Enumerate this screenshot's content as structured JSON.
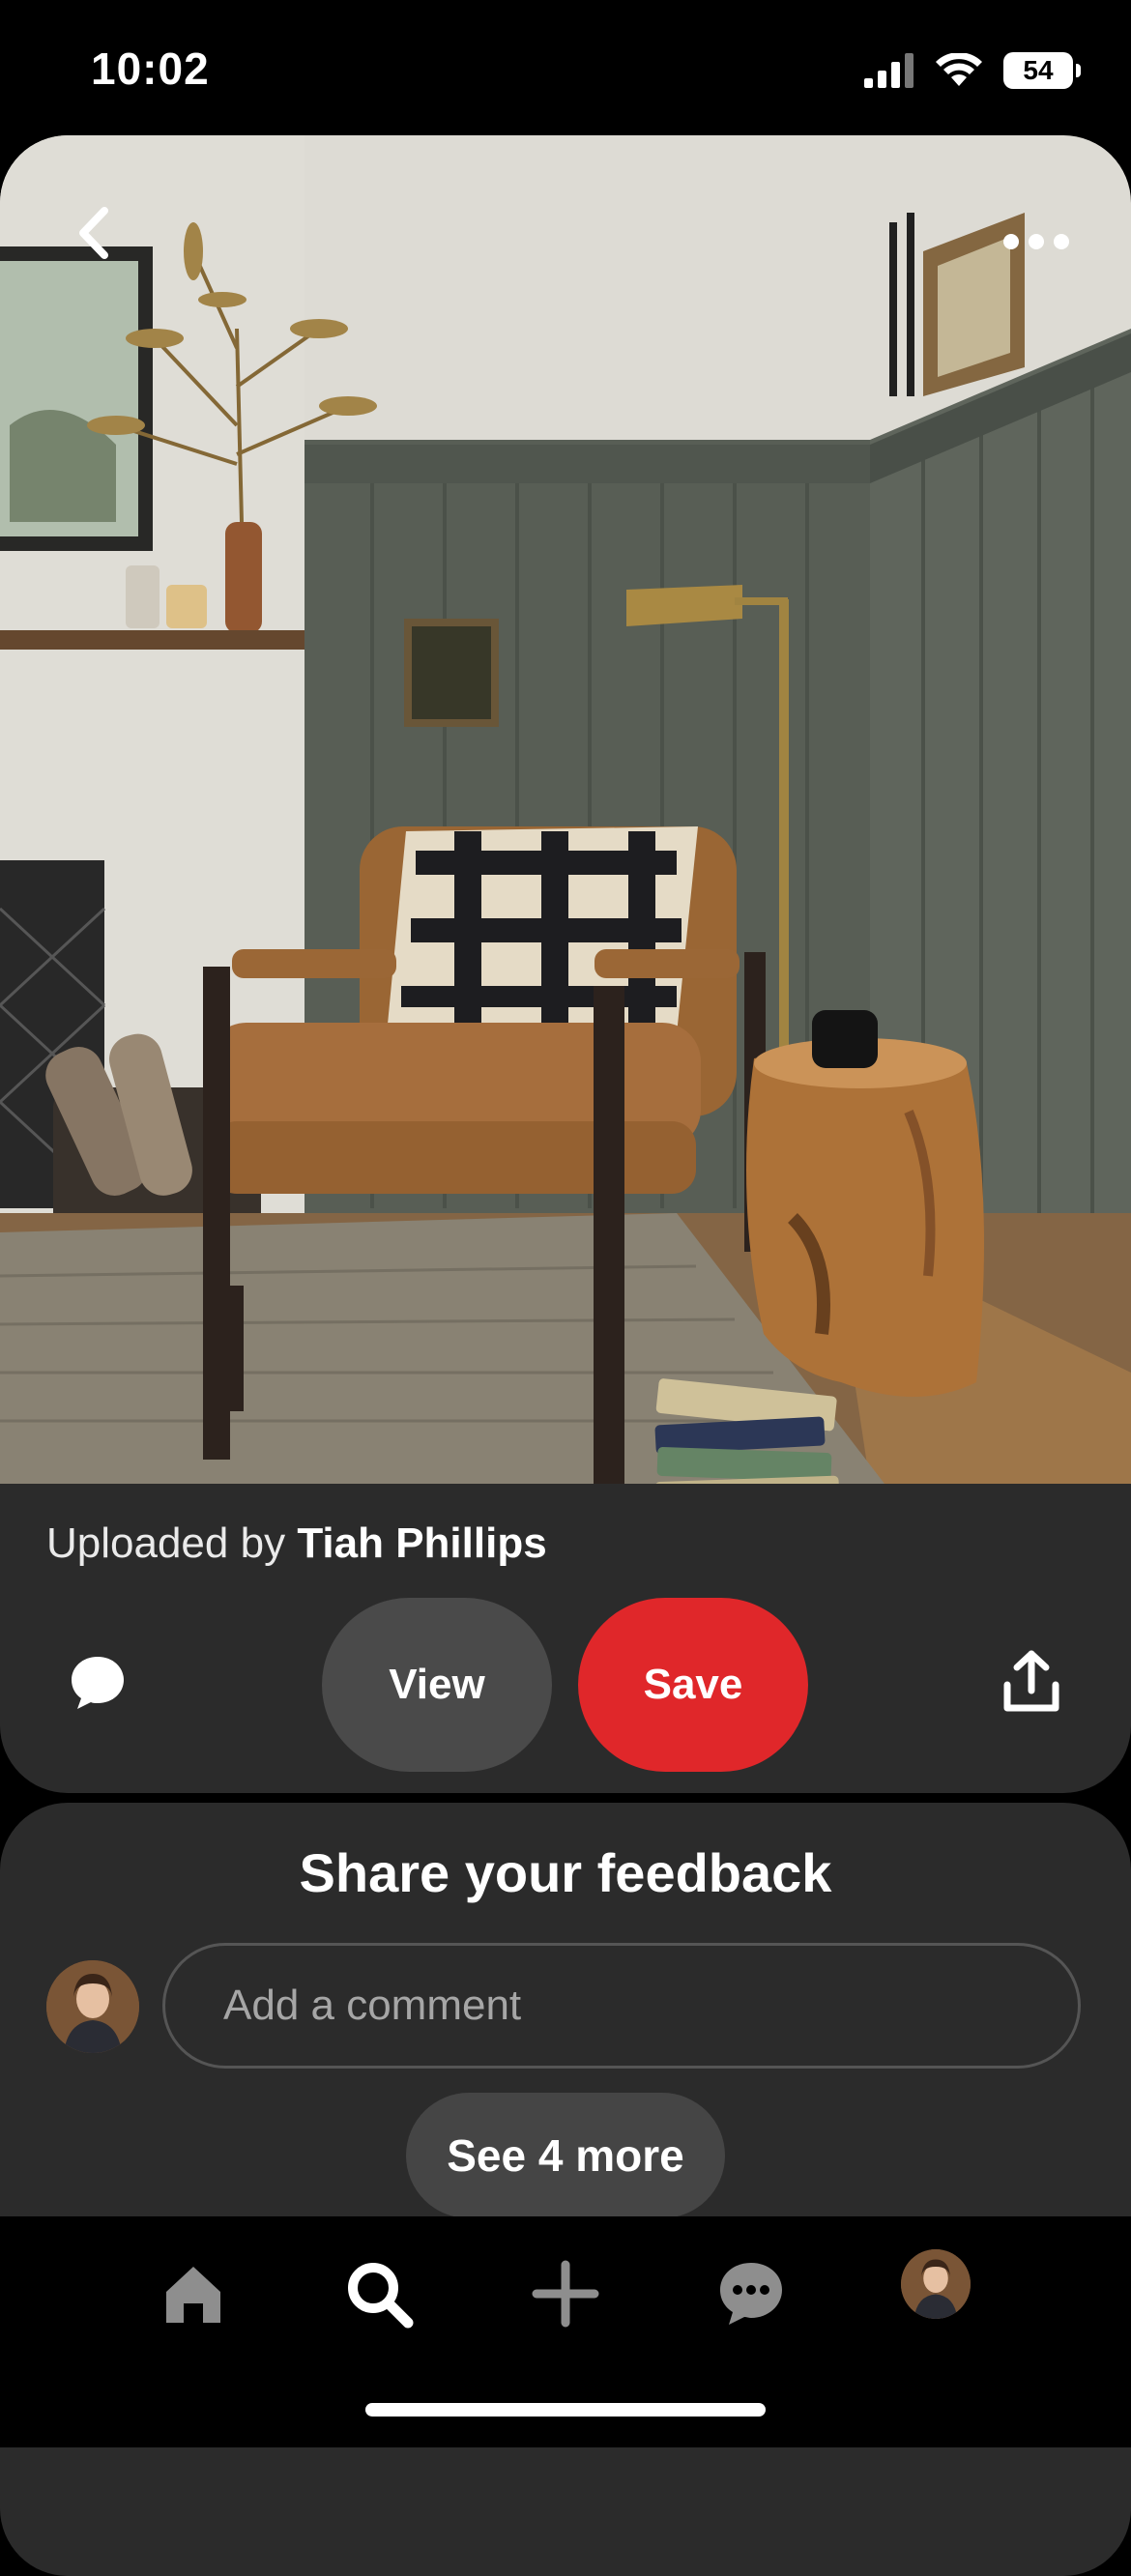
{
  "status_bar": {
    "time": "10:02",
    "battery": "54"
  },
  "pin": {
    "uploaded_prefix": "Uploaded by",
    "uploader": "Tiah Phillips",
    "actions": {
      "view_label": "View",
      "save_label": "Save"
    }
  },
  "feedback": {
    "title": "Share your feedback",
    "comment_placeholder": "Add a comment",
    "see_more_label": "See 4 more"
  },
  "nav": {
    "items": [
      "home-icon",
      "search-icon",
      "create-icon",
      "messages-icon",
      "profile-avatar"
    ],
    "active": "search-icon"
  },
  "colors": {
    "save": "#e0272a",
    "view": "#4a4a4a",
    "card": "#2b2b2b",
    "background": "#000000"
  }
}
